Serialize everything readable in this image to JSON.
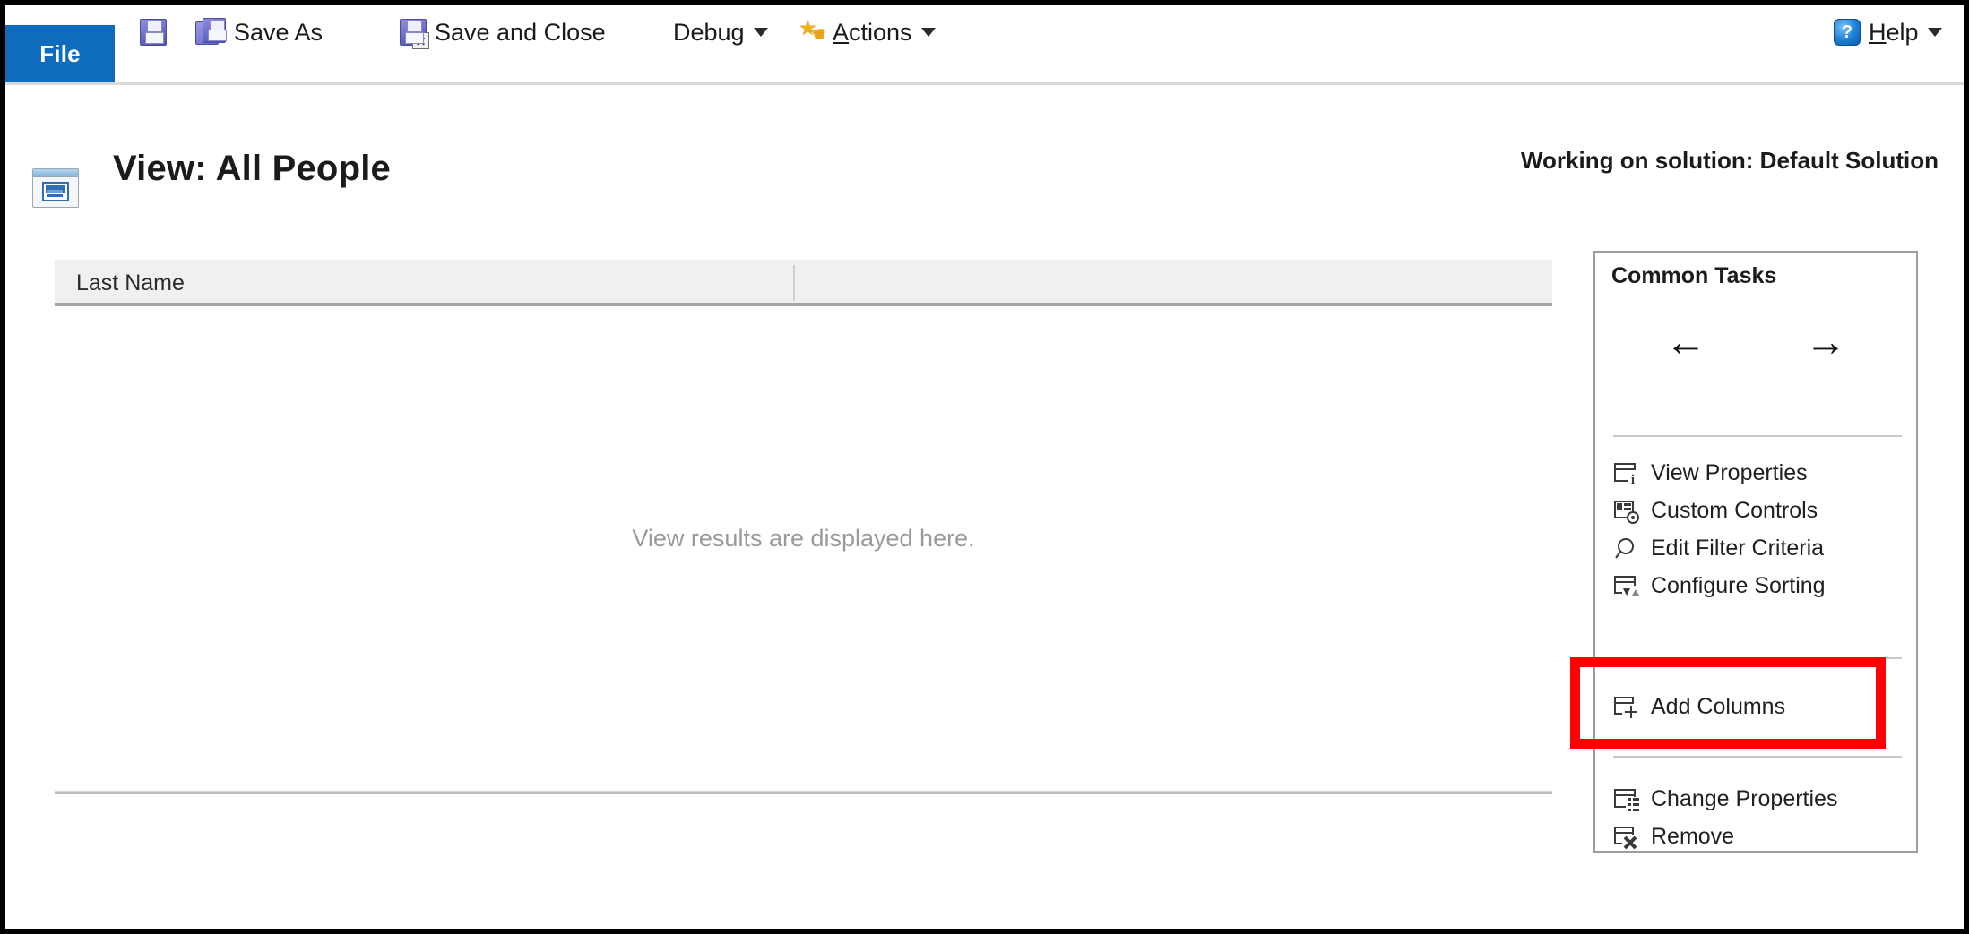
{
  "ribbon": {
    "file_tab": "File",
    "items": [
      {
        "key": "save",
        "label": "",
        "icon": "save-icon"
      },
      {
        "key": "save_as",
        "label": "Save As",
        "icon": "save-as-icon"
      },
      {
        "key": "save_and_close",
        "label": "Save and Close",
        "icon": "save-and-close-icon"
      },
      {
        "key": "debug",
        "label": "Debug",
        "icon": "",
        "has_caret": true
      },
      {
        "key": "actions",
        "label": "Actions",
        "icon": "actions-star-icon",
        "has_caret": true,
        "accel": "A"
      }
    ],
    "debug_label": "Debug",
    "actions_label_prefix": "A",
    "actions_label_rest": "ctions",
    "save_as_label": "Save As",
    "save_and_close_label": "Save and Close",
    "help_label_prefix": "H",
    "help_label_rest": "elp"
  },
  "header": {
    "title": "View: All People",
    "solution": "Working on solution: Default Solution",
    "view_icon": "view-window-icon"
  },
  "grid": {
    "columns": [
      "Last Name"
    ],
    "placeholder": "View results are displayed here.",
    "rows": []
  },
  "tasks": {
    "title": "Common Tasks",
    "nav": {
      "back": "←",
      "forward": "→"
    },
    "items": [
      {
        "label": "View Properties",
        "icon": "view-properties-icon"
      },
      {
        "label": "Custom Controls",
        "icon": "custom-controls-icon"
      },
      {
        "label": "Edit Filter Criteria",
        "icon": "magnifier-icon"
      },
      {
        "label": "Configure Sorting",
        "icon": "sort-icon"
      },
      {
        "label": "Add Columns",
        "icon": "add-column-icon",
        "highlighted": true
      },
      {
        "label": "Change Properties",
        "icon": "change-properties-icon"
      },
      {
        "label": "Remove",
        "icon": "remove-column-icon"
      }
    ]
  },
  "colors": {
    "file_tab_blue": "#0f6cbd",
    "highlight_red": "#ff0000",
    "grid_header_bg": "#f0f0f0",
    "placeholder_gray": "#9a9a9a"
  }
}
